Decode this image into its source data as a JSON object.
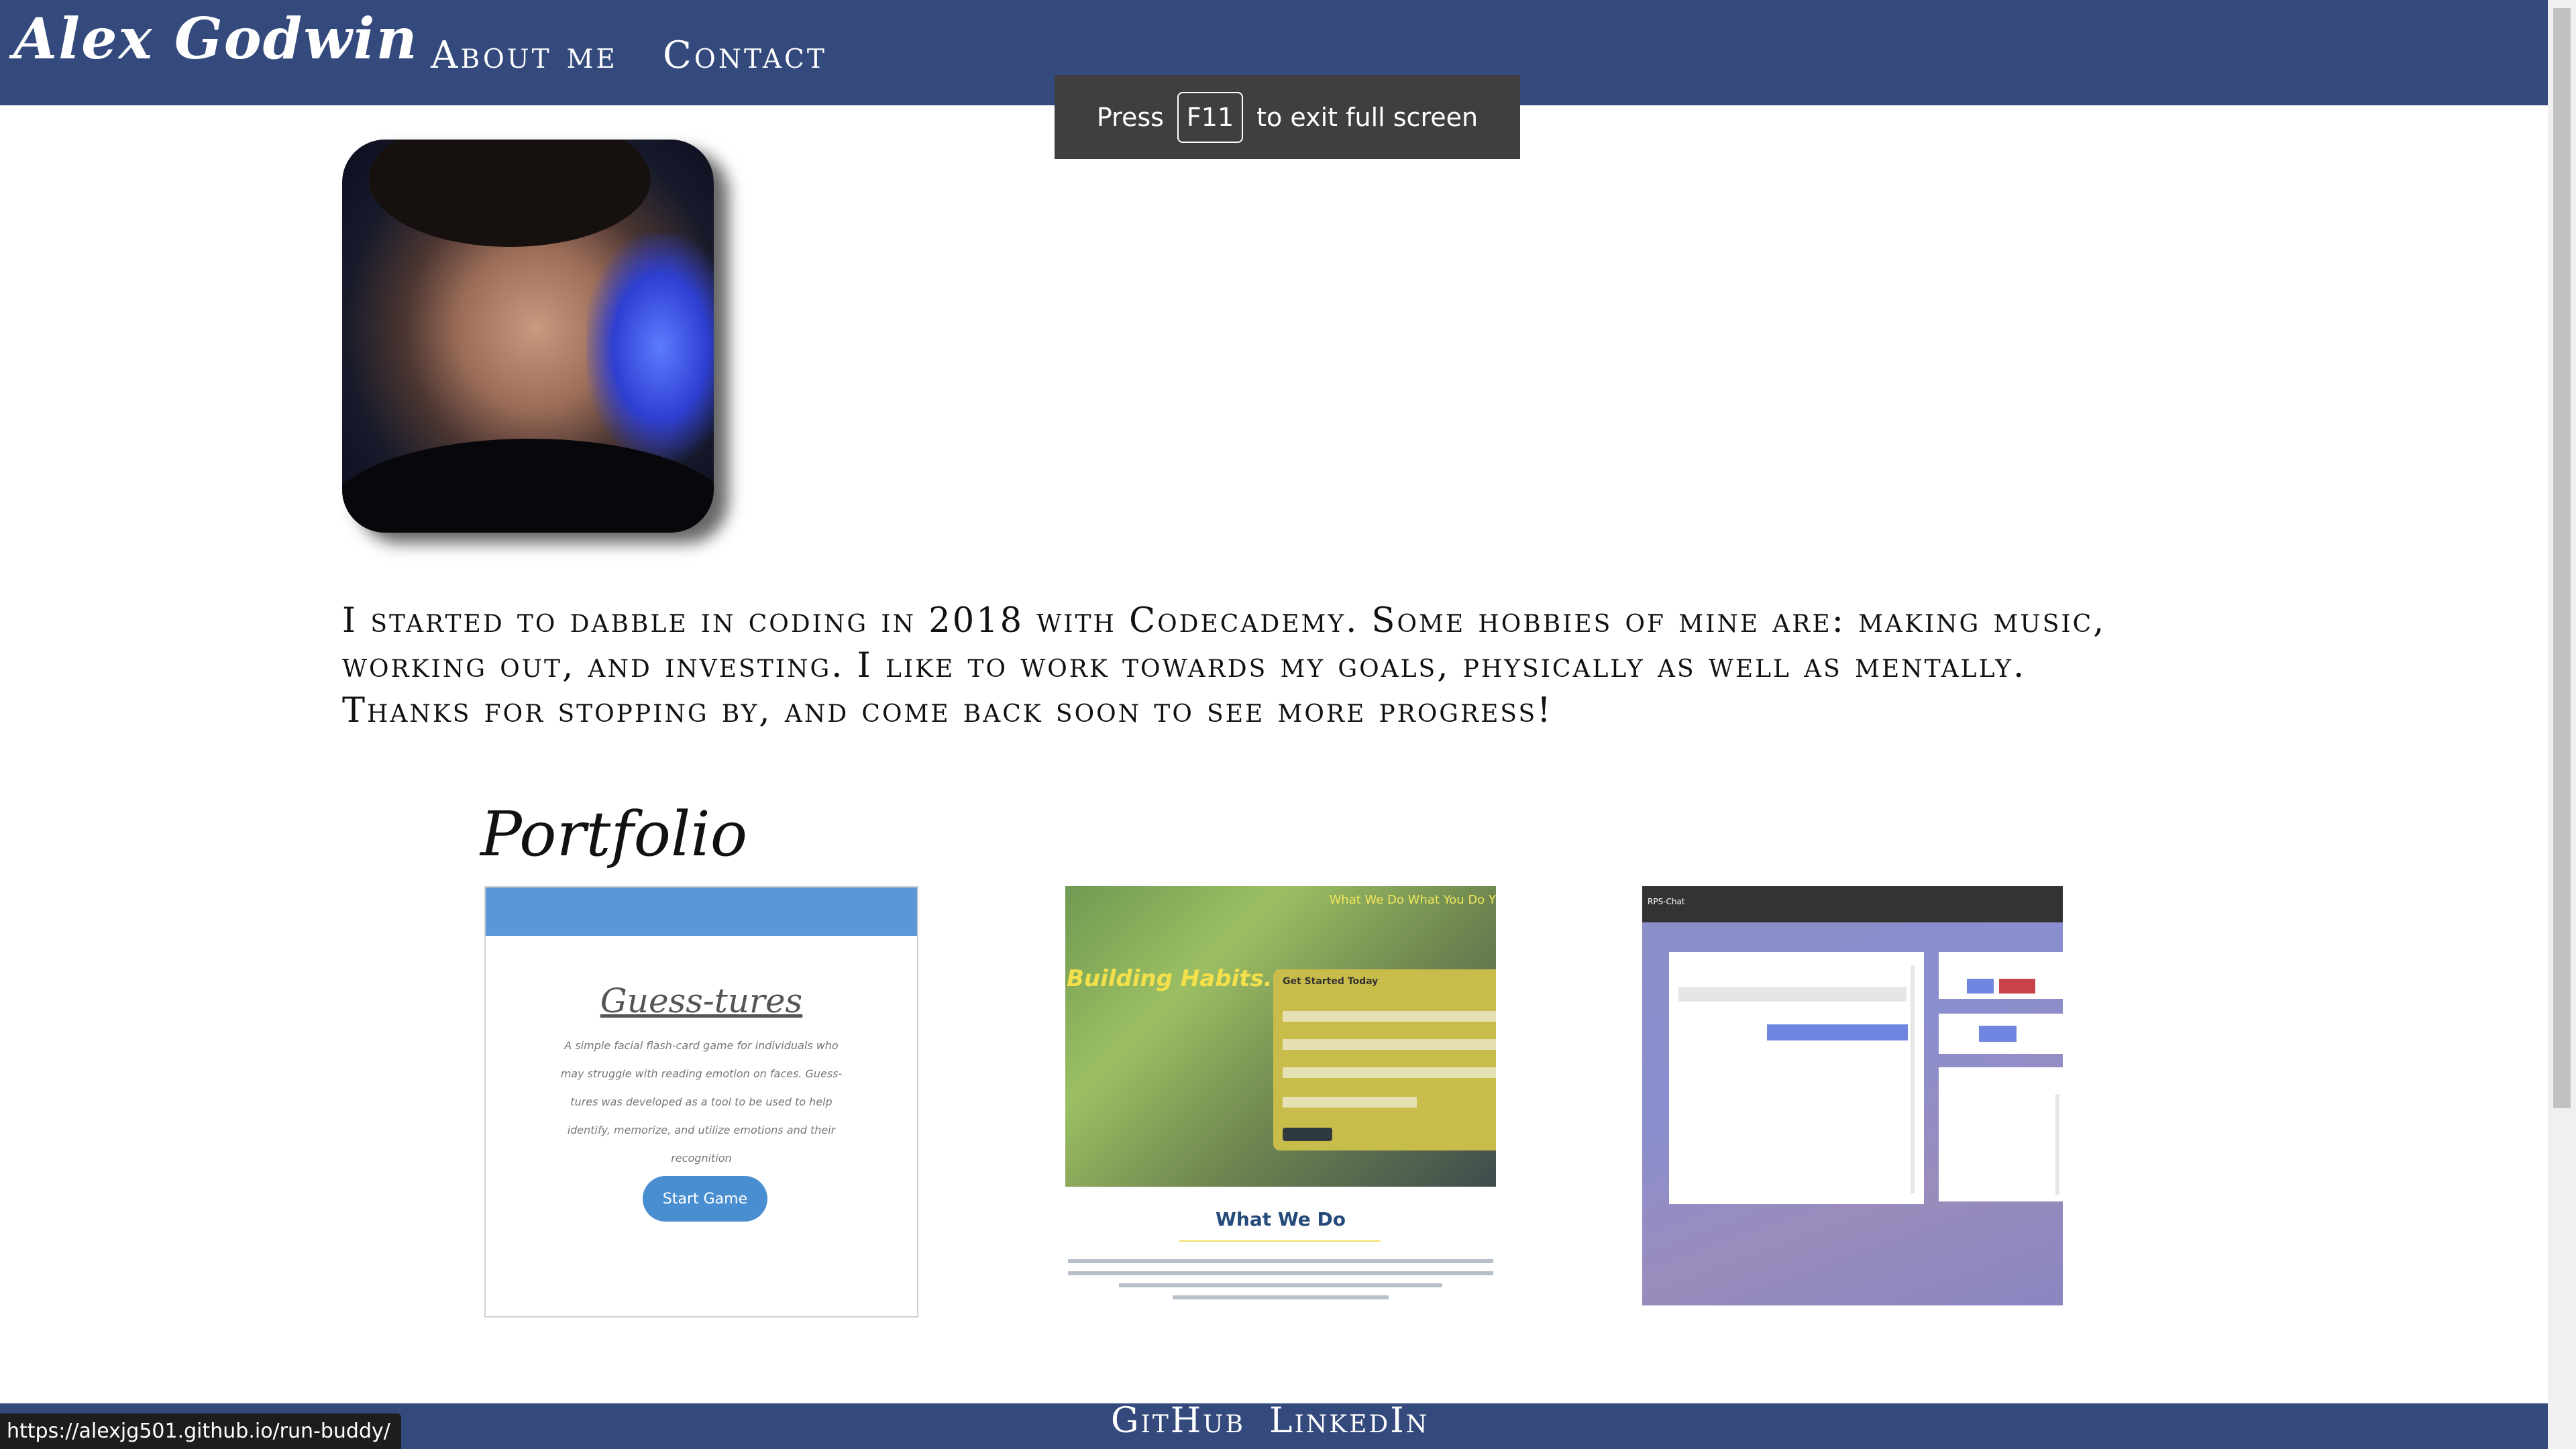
{
  "header": {
    "brand": "Alex Godwin",
    "nav": [
      "About me",
      "Contact"
    ]
  },
  "fullscreen_notice": {
    "prefix": "Press",
    "key": "F11",
    "suffix": "to exit full screen"
  },
  "bio": "I started to dabble in coding in 2018 with Codecademy. Some hobbies of mine are: making music, working out, and investing. I like to work towards my goals, physically as well as mentally. Thanks for stopping by, and come back soon to see more progress!",
  "portfolio": {
    "title": "Portfolio",
    "guess_tures": {
      "title": "Guess-tures",
      "description": "A simple facial flash-card game for individuals who may struggle with reading emotion on faces. Guess-tures was developed as a tool to be used to help identify, memorize, and utilize emotions and their recognition",
      "button": "Start Game"
    },
    "run_buddy": {
      "nav": "What We Do   What You Do   Y",
      "headline": "Building Habits.",
      "form_heading": "Get Started Today",
      "section_heading": "What We Do"
    },
    "rps_chat": {
      "title": "RPS-Chat"
    }
  },
  "footer": {
    "links": [
      "GitHub",
      "LinkedIn"
    ]
  },
  "status_bar": {
    "url": "https://alexjg501.github.io/run-buddy/"
  },
  "colors": {
    "header_bg": "#344a7d",
    "footer_bg": "#344a7d"
  }
}
